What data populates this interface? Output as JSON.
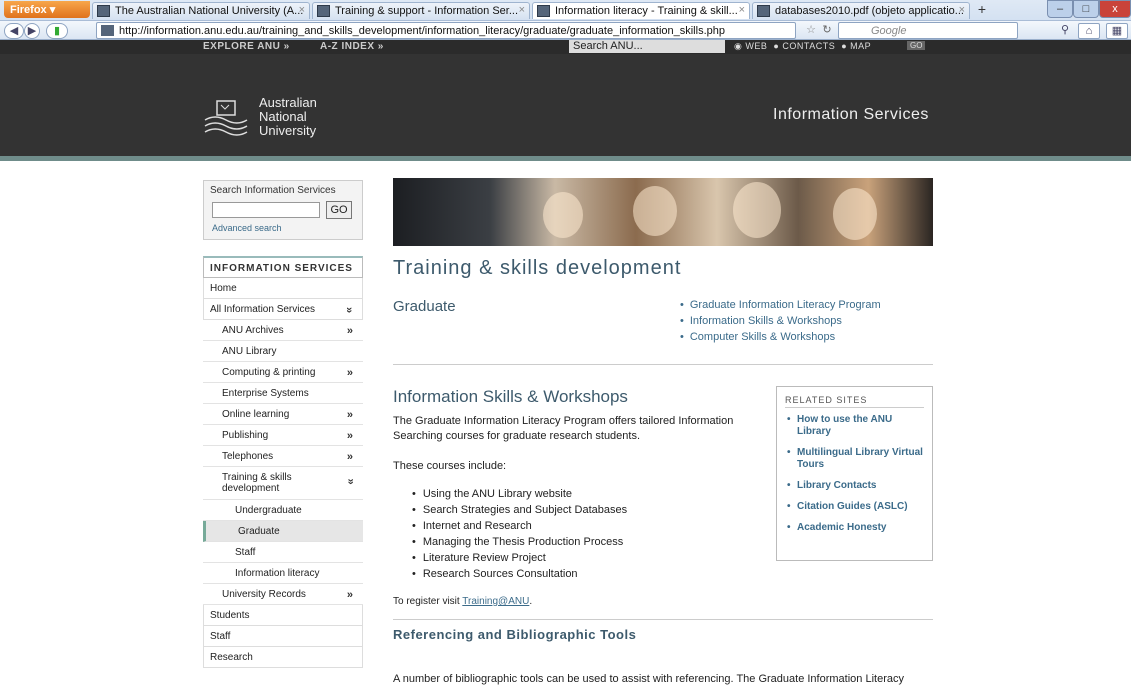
{
  "browser": {
    "app_button": "Firefox",
    "tabs": [
      {
        "label": "The Australian National University (A..."
      },
      {
        "label": "Training & support - Information Ser..."
      },
      {
        "label": "Information literacy - Training & skill..."
      },
      {
        "label": "databases2010.pdf (objeto applicatio..."
      }
    ],
    "url": "http://information.anu.edu.au/training_and_skills_development/information_literacy/graduate/graduate_information_skills.php",
    "search_placeholder": "Google",
    "window_controls": {
      "minimize": "–",
      "maximize": "□",
      "close": "x"
    }
  },
  "anu_header": {
    "explore": "EXPLORE ANU »",
    "az_index": "A-Z INDEX »",
    "search_value": "Search ANU...",
    "radio_web": "WEB",
    "radio_contacts": "CONTACTS",
    "radio_map": "MAP",
    "go": "GO",
    "logo_line1": "Australian",
    "logo_line2": "National",
    "logo_line3": "University",
    "site_title": "Information Services"
  },
  "sidebar": {
    "search_label": "Search Information Services",
    "go": "GO",
    "advanced": "Advanced search",
    "nav_heading": "INFORMATION SERVICES",
    "items": [
      {
        "label": "Home"
      },
      {
        "label": "All Information Services",
        "chev": "»"
      },
      {
        "label": "ANU Archives",
        "chev": "»"
      },
      {
        "label": "ANU Library"
      },
      {
        "label": "Computing & printing",
        "chev": "»"
      },
      {
        "label": "Enterprise Systems"
      },
      {
        "label": "Online learning",
        "chev": "»"
      },
      {
        "label": "Publishing",
        "chev": "»"
      },
      {
        "label": "Telephones",
        "chev": "»"
      },
      {
        "label": "Training & skills development",
        "chev": "»"
      },
      {
        "label": "Undergraduate"
      },
      {
        "label": "Graduate"
      },
      {
        "label": "Staff"
      },
      {
        "label": "Information literacy"
      },
      {
        "label": "University Records",
        "chev": "»"
      },
      {
        "label": "Students"
      },
      {
        "label": "Staff"
      },
      {
        "label": "Research"
      }
    ]
  },
  "main": {
    "title": "Training & skills development",
    "subtitle": "Graduate",
    "links": [
      "Graduate Information Literacy Program",
      "Information Skills & Workshops",
      "Computer Skills & Workshops"
    ],
    "section_title": "Information Skills & Workshops",
    "intro": "The Graduate Information Literacy Program offers tailored Information Searching courses for graduate research students.",
    "courses_intro": "These courses include:",
    "courses": [
      "Using the ANU Library website",
      "Search Strategies and Subject Databases",
      "Internet and Research",
      "Managing the Thesis Production Process",
      "Literature Review Project",
      "Research Sources Consultation"
    ],
    "register_prefix": "To register visit ",
    "register_link": "Training@ANU",
    "register_suffix": ".",
    "ref_title": "Referencing and Bibliographic Tools",
    "ref_text": "A number of bibliographic tools can be used to assist with referencing. The Graduate Information Literacy"
  },
  "related": {
    "heading": "RELATED SITES",
    "items": [
      "How to use the ANU Library",
      "Multilingual Library Virtual Tours",
      "Library Contacts",
      "Citation Guides (ASLC)",
      "Academic Honesty"
    ]
  }
}
